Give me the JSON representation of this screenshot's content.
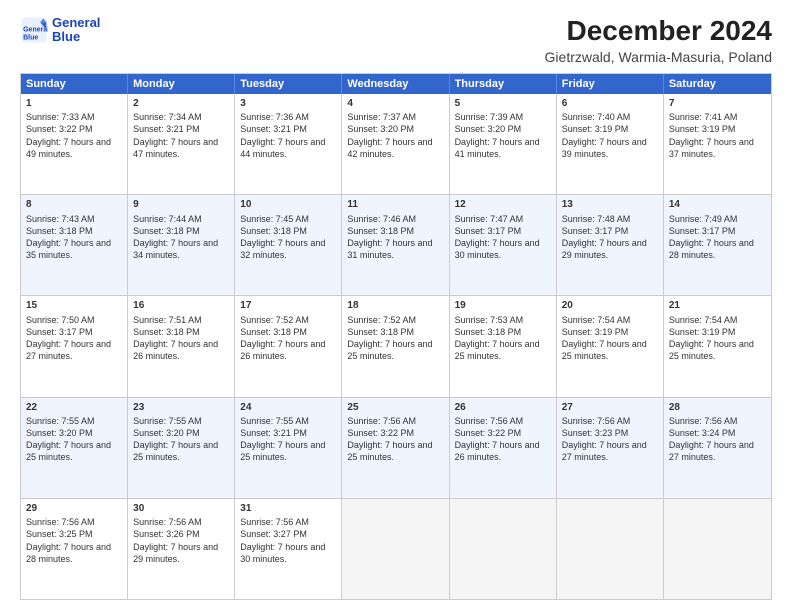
{
  "header": {
    "logo_line1": "General",
    "logo_line2": "Blue",
    "title": "December 2024",
    "subtitle": "Gietrzwald, Warmia-Masuria, Poland"
  },
  "weekdays": [
    "Sunday",
    "Monday",
    "Tuesday",
    "Wednesday",
    "Thursday",
    "Friday",
    "Saturday"
  ],
  "rows": [
    [
      {
        "day": "1",
        "sunrise": "7:33 AM",
        "sunset": "3:22 PM",
        "daylight": "7 hours and 49 minutes."
      },
      {
        "day": "2",
        "sunrise": "7:34 AM",
        "sunset": "3:21 PM",
        "daylight": "7 hours and 47 minutes."
      },
      {
        "day": "3",
        "sunrise": "7:36 AM",
        "sunset": "3:21 PM",
        "daylight": "7 hours and 44 minutes."
      },
      {
        "day": "4",
        "sunrise": "7:37 AM",
        "sunset": "3:20 PM",
        "daylight": "7 hours and 42 minutes."
      },
      {
        "day": "5",
        "sunrise": "7:39 AM",
        "sunset": "3:20 PM",
        "daylight": "7 hours and 41 minutes."
      },
      {
        "day": "6",
        "sunrise": "7:40 AM",
        "sunset": "3:19 PM",
        "daylight": "7 hours and 39 minutes."
      },
      {
        "day": "7",
        "sunrise": "7:41 AM",
        "sunset": "3:19 PM",
        "daylight": "7 hours and 37 minutes."
      }
    ],
    [
      {
        "day": "8",
        "sunrise": "7:43 AM",
        "sunset": "3:18 PM",
        "daylight": "7 hours and 35 minutes."
      },
      {
        "day": "9",
        "sunrise": "7:44 AM",
        "sunset": "3:18 PM",
        "daylight": "7 hours and 34 minutes."
      },
      {
        "day": "10",
        "sunrise": "7:45 AM",
        "sunset": "3:18 PM",
        "daylight": "7 hours and 32 minutes."
      },
      {
        "day": "11",
        "sunrise": "7:46 AM",
        "sunset": "3:18 PM",
        "daylight": "7 hours and 31 minutes."
      },
      {
        "day": "12",
        "sunrise": "7:47 AM",
        "sunset": "3:17 PM",
        "daylight": "7 hours and 30 minutes."
      },
      {
        "day": "13",
        "sunrise": "7:48 AM",
        "sunset": "3:17 PM",
        "daylight": "7 hours and 29 minutes."
      },
      {
        "day": "14",
        "sunrise": "7:49 AM",
        "sunset": "3:17 PM",
        "daylight": "7 hours and 28 minutes."
      }
    ],
    [
      {
        "day": "15",
        "sunrise": "7:50 AM",
        "sunset": "3:17 PM",
        "daylight": "7 hours and 27 minutes."
      },
      {
        "day": "16",
        "sunrise": "7:51 AM",
        "sunset": "3:18 PM",
        "daylight": "7 hours and 26 minutes."
      },
      {
        "day": "17",
        "sunrise": "7:52 AM",
        "sunset": "3:18 PM",
        "daylight": "7 hours and 26 minutes."
      },
      {
        "day": "18",
        "sunrise": "7:52 AM",
        "sunset": "3:18 PM",
        "daylight": "7 hours and 25 minutes."
      },
      {
        "day": "19",
        "sunrise": "7:53 AM",
        "sunset": "3:18 PM",
        "daylight": "7 hours and 25 minutes."
      },
      {
        "day": "20",
        "sunrise": "7:54 AM",
        "sunset": "3:19 PM",
        "daylight": "7 hours and 25 minutes."
      },
      {
        "day": "21",
        "sunrise": "7:54 AM",
        "sunset": "3:19 PM",
        "daylight": "7 hours and 25 minutes."
      }
    ],
    [
      {
        "day": "22",
        "sunrise": "7:55 AM",
        "sunset": "3:20 PM",
        "daylight": "7 hours and 25 minutes."
      },
      {
        "day": "23",
        "sunrise": "7:55 AM",
        "sunset": "3:20 PM",
        "daylight": "7 hours and 25 minutes."
      },
      {
        "day": "24",
        "sunrise": "7:55 AM",
        "sunset": "3:21 PM",
        "daylight": "7 hours and 25 minutes."
      },
      {
        "day": "25",
        "sunrise": "7:56 AM",
        "sunset": "3:22 PM",
        "daylight": "7 hours and 25 minutes."
      },
      {
        "day": "26",
        "sunrise": "7:56 AM",
        "sunset": "3:22 PM",
        "daylight": "7 hours and 26 minutes."
      },
      {
        "day": "27",
        "sunrise": "7:56 AM",
        "sunset": "3:23 PM",
        "daylight": "7 hours and 27 minutes."
      },
      {
        "day": "28",
        "sunrise": "7:56 AM",
        "sunset": "3:24 PM",
        "daylight": "7 hours and 27 minutes."
      }
    ],
    [
      {
        "day": "29",
        "sunrise": "7:56 AM",
        "sunset": "3:25 PM",
        "daylight": "7 hours and 28 minutes."
      },
      {
        "day": "30",
        "sunrise": "7:56 AM",
        "sunset": "3:26 PM",
        "daylight": "7 hours and 29 minutes."
      },
      {
        "day": "31",
        "sunrise": "7:56 AM",
        "sunset": "3:27 PM",
        "daylight": "7 hours and 30 minutes."
      },
      null,
      null,
      null,
      null
    ]
  ],
  "labels": {
    "sunrise_prefix": "Sunrise: ",
    "sunset_prefix": "Sunset: ",
    "daylight_label": "Daylight: "
  }
}
